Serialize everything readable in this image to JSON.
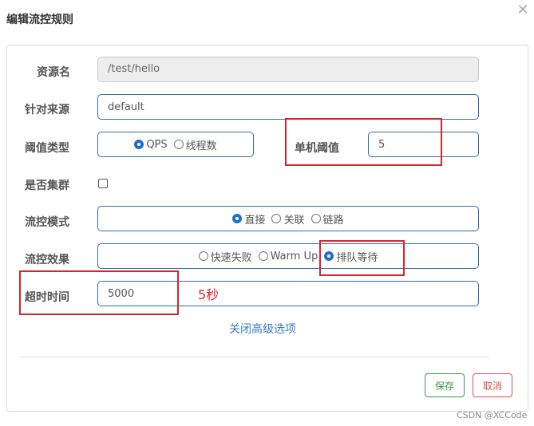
{
  "dialog": {
    "title": "编辑流控规则",
    "close_glyph": "✕"
  },
  "form": {
    "resource": {
      "label": "资源名",
      "value": "/test/hello"
    },
    "source": {
      "label": "针对来源",
      "value": "default"
    },
    "threshold_type": {
      "label": "阈值类型",
      "options": [
        "QPS",
        "线程数"
      ],
      "selected": "QPS"
    },
    "single_threshold": {
      "label": "单机阈值",
      "value": "5"
    },
    "cluster": {
      "label": "是否集群",
      "checked": false
    },
    "mode": {
      "label": "流控模式",
      "options": [
        "直接",
        "关联",
        "链路"
      ],
      "selected": "直接"
    },
    "effect": {
      "label": "流控效果",
      "options": [
        "快速失败",
        "Warm Up",
        "排队等待"
      ],
      "selected": "排队等待"
    },
    "timeout": {
      "label": "超时时间",
      "value": "5000"
    },
    "advanced_link": "关闭高级选项"
  },
  "annotation": {
    "text": "5秒",
    "color": "#d9232d"
  },
  "buttons": {
    "save": "保存",
    "cancel": "取消"
  },
  "watermark": "CSDN @XCCode"
}
